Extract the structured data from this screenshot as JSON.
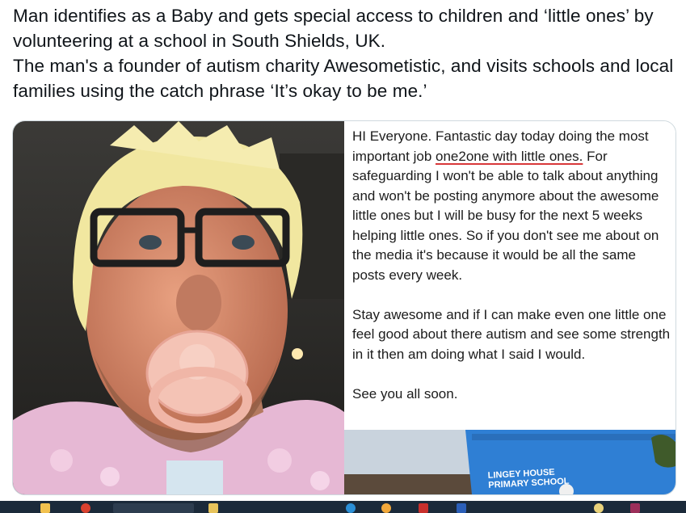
{
  "tweet": {
    "paragraph1": "Man identifies as a Baby and  gets special access to children and ‘little ones’ by volunteering at a school in South Shields, UK.",
    "paragraph2": "The man's a founder of autism charity Awesometistic, and visits schools and local families using the catch phrase ‘It’s okay to be me.’"
  },
  "post": {
    "line1_before": "HI Everyone. Fantastic day today doing the most important job ",
    "line1_underlined": "one2one with little ones.",
    "line1_after": " For safeguarding I won't be able to talk about anything and won't be posting anymore about the awesome little ones but I will be busy for the next 5 weeks helping little ones. So if you don't see me about on the media it's because it would be all the same posts every week.",
    "paragraph2": "Stay awesome and if I can make even one little one feel good about there autism and see some strength in it then am doing what I said I would.",
    "paragraph3": "See you all soon."
  },
  "school_sign": {
    "line1": "LINGEY HOUSE",
    "line2": "PRIMARY SCHOOL"
  },
  "colors": {
    "underline": "#d8383a",
    "sign_blue": "#2f7fd4",
    "taskbar": "#1b2a3a",
    "card_border": "#cfd9de"
  },
  "taskbar_icons": [
    "window-icon",
    "chrome-icon",
    "app-icon",
    "folder-icon",
    "edge-icon",
    "app-icon-2",
    "pdf-icon",
    "word-icon",
    "app-icon-3",
    "app-icon-4"
  ]
}
